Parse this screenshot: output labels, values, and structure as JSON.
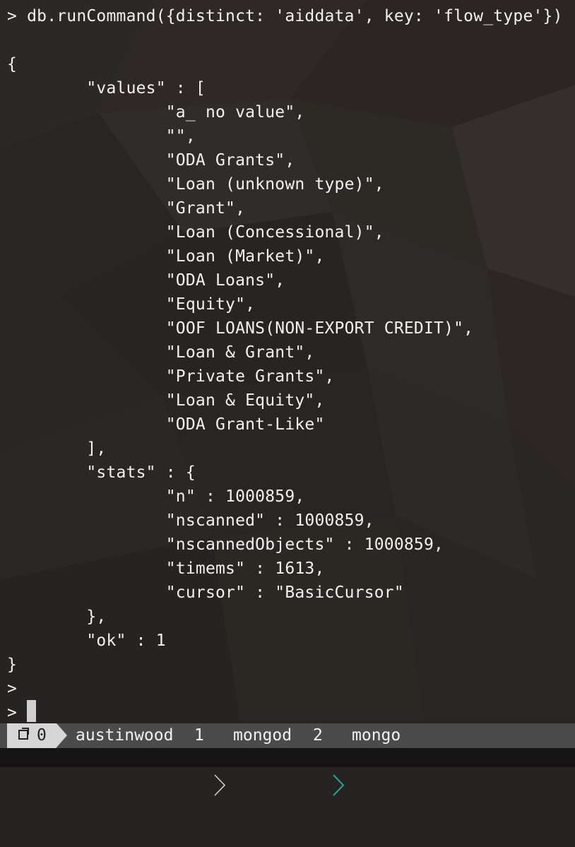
{
  "terminal": {
    "lines": [
      "> db.runCommand({distinct: 'aiddata', key: 'flow_type'})",
      "",
      "{",
      "        \"values\" : [",
      "                \"a_ no value\",",
      "                \"\",",
      "                \"ODA Grants\",",
      "                \"Loan (unknown type)\",",
      "                \"Grant\",",
      "                \"Loan (Concessional)\",",
      "                \"Loan (Market)\",",
      "                \"ODA Loans\",",
      "                \"Equity\",",
      "                \"OOF LOANS(NON-EXPORT CREDIT)\",",
      "                \"Loan & Grant\",",
      "                \"Private Grants\",",
      "                \"Loan & Equity\",",
      "                \"ODA Grant-Like\"",
      "        ],",
      "        \"stats\" : {",
      "                \"n\" : 1000859,",
      "                \"nscanned\" : 1000859,",
      "                \"nscannedObjects\" : 1000859,",
      "                \"timems\" : 1613,",
      "                \"cursor\" : \"BasicCursor\"",
      "        },",
      "        \"ok\" : 1",
      "}",
      ">",
      ">"
    ]
  },
  "statusbar": {
    "session_icon": "window-icon",
    "session_number": "0",
    "user": "austinwood",
    "window1_index": "1",
    "window1_name": "mongod",
    "window2_index": "2",
    "window2_name": "mongo",
    "colors": {
      "bar": "#4b4b4b",
      "session_bg": "#d6d6d6",
      "active_chevron": "#2aa198",
      "inactive_chevron": "#d0d0d0"
    }
  }
}
